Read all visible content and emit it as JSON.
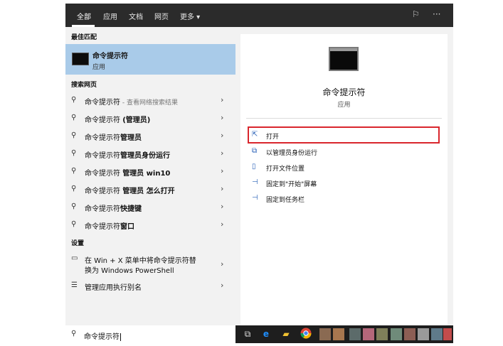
{
  "tabs": [
    "全部",
    "应用",
    "文档",
    "网页",
    "更多 ▾"
  ],
  "top_icons": [
    "feedback-icon",
    "more-icon"
  ],
  "sections": {
    "best_match": "最佳匹配",
    "web_search": "搜索网页",
    "settings": "设置"
  },
  "best_match": {
    "title": "命令提示符",
    "subtitle": "应用"
  },
  "web_results": [
    {
      "text": "命令提示符",
      "suffix": " - 查看网络搜索结果"
    },
    {
      "text": "命令提示符 ",
      "bold": "(管理员)"
    },
    {
      "text": "命令提示符",
      "bold": "管理员"
    },
    {
      "text": "命令提示符",
      "bold": "管理员身份运行"
    },
    {
      "text": "命令提示符 ",
      "bold": "管理员 win10"
    },
    {
      "text": "命令提示符 ",
      "bold": "管理员 怎么打开"
    },
    {
      "text": "命令提示符",
      "bold": "快捷键"
    },
    {
      "text": "命令提示符",
      "bold": "窗口"
    }
  ],
  "settings_results": [
    {
      "line1": "在 Win + X 菜单中将命令提示符替",
      "line2": "换为 Windows PowerShell"
    },
    {
      "line1": "管理应用执行别名"
    }
  ],
  "details": {
    "title": "命令提示符",
    "type": "应用",
    "actions": [
      {
        "label": "打开",
        "icon": "open-icon"
      },
      {
        "label": "以管理员身份运行",
        "icon": "run-as-admin-icon"
      },
      {
        "label": "打开文件位置",
        "icon": "file-location-icon"
      },
      {
        "label": "固定到\"开始\"屏幕",
        "icon": "pin-start-icon"
      },
      {
        "label": "固定到任务栏",
        "icon": "pin-taskbar-icon"
      }
    ]
  },
  "search": {
    "value": "命令提示符"
  },
  "colors": {
    "selected": "#a9cbe9",
    "highlight_box": "#d9262d",
    "topbar": "#2b2b2b"
  }
}
